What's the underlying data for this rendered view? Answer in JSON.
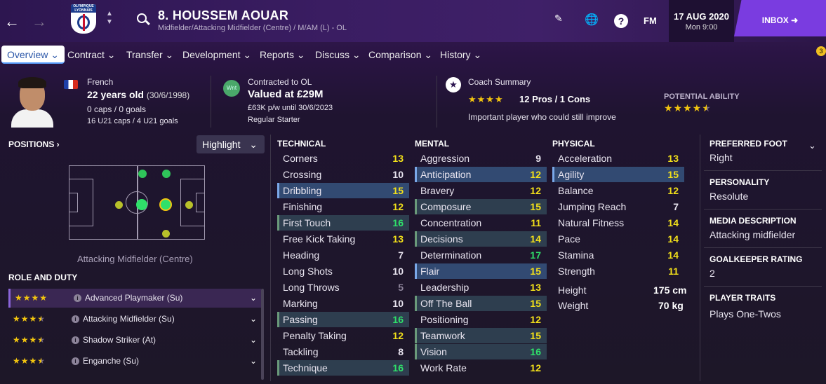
{
  "header": {
    "player_name": "8. HOUSSEM AOUAR",
    "subtitle": "Midfielder/Attacking Midfielder (Centre) / M/AM (L) - OL",
    "club_crest_text": "OLYMPIQUE LYONNAIS",
    "fm_label": "FM",
    "date": "17 AUG 2020",
    "time": "Mon 9:00",
    "inbox_label": "INBOX"
  },
  "tabs": [
    "Overview",
    "Contract",
    "Transfer",
    "Development",
    "Reports",
    "Discuss",
    "Comparison",
    "History"
  ],
  "notification_count": "3",
  "bio": {
    "nationality": "French",
    "age": "22 years old",
    "dob": "(30/6/1998)",
    "caps": "0 caps / 0 goals",
    "u21": "16 U21 caps / 4 U21 goals"
  },
  "contract": {
    "status_icon": "Wnt",
    "contracted": "Contracted to OL",
    "value": "Valued at £29M",
    "wage": "£63K p/w until 30/6/2023",
    "role": "Regular Starter"
  },
  "coach": {
    "label": "Coach Summary",
    "stars": 4,
    "pros_cons": "12 Pros / 1 Cons",
    "summary": "Important player who could still improve",
    "potential_label": "POTENTIAL ABILITY",
    "potential_stars": 4.5
  },
  "positions": {
    "label": "POSITIONS",
    "highlight_label": "Highlight",
    "position_name": "Attacking Midfielder (Centre)"
  },
  "role_duty": {
    "label": "ROLE AND DUTY",
    "roles": [
      {
        "name": "Advanced Playmaker (Su)",
        "stars": 4
      },
      {
        "name": "Attacking Midfielder (Su)",
        "stars": 3.5
      },
      {
        "name": "Shadow Striker (At)",
        "stars": 3.5
      },
      {
        "name": "Enganche (Su)",
        "stars": 3.5
      }
    ]
  },
  "technical": {
    "label": "TECHNICAL",
    "attrs": [
      {
        "name": "Corners",
        "value": "13"
      },
      {
        "name": "Crossing",
        "value": "10"
      },
      {
        "name": "Dribbling",
        "value": "15"
      },
      {
        "name": "Finishing",
        "value": "12"
      },
      {
        "name": "First Touch",
        "value": "16"
      },
      {
        "name": "Free Kick Taking",
        "value": "13"
      },
      {
        "name": "Heading",
        "value": "7"
      },
      {
        "name": "Long Shots",
        "value": "10"
      },
      {
        "name": "Long Throws",
        "value": "5"
      },
      {
        "name": "Marking",
        "value": "10"
      },
      {
        "name": "Passing",
        "value": "16"
      },
      {
        "name": "Penalty Taking",
        "value": "12"
      },
      {
        "name": "Tackling",
        "value": "8"
      },
      {
        "name": "Technique",
        "value": "16"
      }
    ]
  },
  "mental": {
    "label": "MENTAL",
    "attrs": [
      {
        "name": "Aggression",
        "value": "9"
      },
      {
        "name": "Anticipation",
        "value": "12"
      },
      {
        "name": "Bravery",
        "value": "12"
      },
      {
        "name": "Composure",
        "value": "15"
      },
      {
        "name": "Concentration",
        "value": "11"
      },
      {
        "name": "Decisions",
        "value": "14"
      },
      {
        "name": "Determination",
        "value": "17"
      },
      {
        "name": "Flair",
        "value": "15"
      },
      {
        "name": "Leadership",
        "value": "13"
      },
      {
        "name": "Off The Ball",
        "value": "15"
      },
      {
        "name": "Positioning",
        "value": "12"
      },
      {
        "name": "Teamwork",
        "value": "15"
      },
      {
        "name": "Vision",
        "value": "16"
      },
      {
        "name": "Work Rate",
        "value": "12"
      }
    ]
  },
  "physical": {
    "label": "PHYSICAL",
    "attrs": [
      {
        "name": "Acceleration",
        "value": "13"
      },
      {
        "name": "Agility",
        "value": "15"
      },
      {
        "name": "Balance",
        "value": "12"
      },
      {
        "name": "Jumping Reach",
        "value": "7"
      },
      {
        "name": "Natural Fitness",
        "value": "14"
      },
      {
        "name": "Pace",
        "value": "14"
      },
      {
        "name": "Stamina",
        "value": "14"
      },
      {
        "name": "Strength",
        "value": "11"
      }
    ],
    "height_label": "Height",
    "height": "175 cm",
    "weight_label": "Weight",
    "weight": "70 kg"
  },
  "side": {
    "foot_label": "PREFERRED FOOT",
    "foot": "Right",
    "personality_label": "PERSONALITY",
    "personality": "Resolute",
    "media_label": "MEDIA DESCRIPTION",
    "media": "Attacking midfielder",
    "gk_label": "GOALKEEPER RATING",
    "gk": "2",
    "traits_label": "PLAYER TRAITS",
    "traits": "Plays One-Twos"
  },
  "colors": {
    "accent": "#7a3ce0",
    "elite": "#2fe06a",
    "good": "#f2e01a",
    "avg": "#e8e4ef",
    "low": "#8c8399"
  }
}
